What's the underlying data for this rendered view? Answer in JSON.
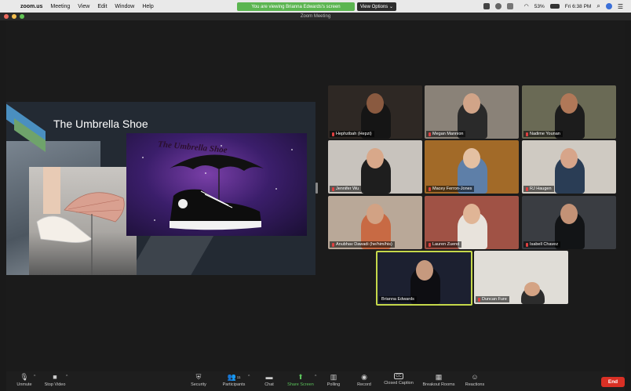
{
  "menubar": {
    "app_name": "zoom.us",
    "items": [
      "Meeting",
      "View",
      "Edit",
      "Window",
      "Help"
    ],
    "share_banner": "You are viewing Brianna Edwards's screen",
    "view_options": "View Options ⌄",
    "battery": "53%",
    "clock": "Fri 6:38 PM"
  },
  "window": {
    "title": "Zoom Meeting"
  },
  "slide": {
    "title": "The Umbrella Shoe",
    "galaxy_text": "The Umbrella Shoe"
  },
  "participants": [
    {
      "name": "Hephzibah (Hepzi)"
    },
    {
      "name": "Megan Mannion"
    },
    {
      "name": "Nadime Younan"
    },
    {
      "name": "Jennifer Wu"
    },
    {
      "name": "Macey Ferron-Jones"
    },
    {
      "name": "RJ Haugen"
    },
    {
      "name": "Anubhav Dawadi (he/him/his)"
    },
    {
      "name": "Lauren Zuend"
    },
    {
      "name": "Isabell Chavez"
    },
    {
      "name": "Brianna Edwards"
    },
    {
      "name": "Duncan Fure"
    }
  ],
  "toolbar": {
    "unmute": "Unmute",
    "stop_video": "Stop Video",
    "security": "Security",
    "participants": "Participants",
    "participants_count": "11",
    "chat": "Chat",
    "share_screen": "Share Screen",
    "polling": "Polling",
    "record": "Record",
    "closed_caption": "Closed Caption",
    "breakout_rooms": "Breakout Rooms",
    "reactions": "Reactions",
    "end": "End"
  },
  "colors": {
    "share_banner": "#5bb550",
    "active_speaker_border": "#c5d84a",
    "end_button": "#d93025"
  }
}
